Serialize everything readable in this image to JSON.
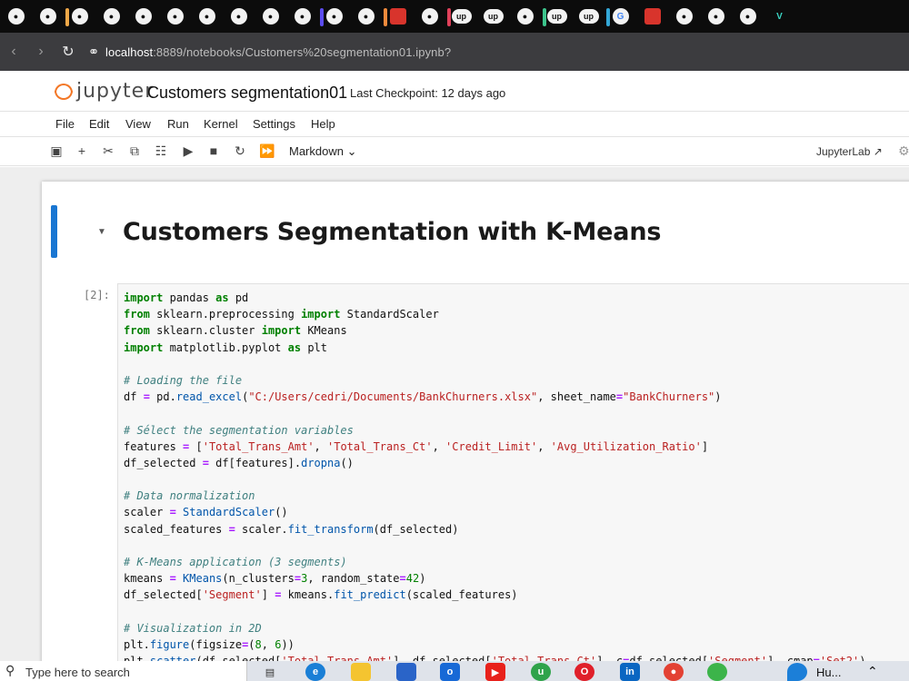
{
  "browser": {
    "tabs": [
      {
        "icon": "gh",
        "accent": "",
        "active": false
      },
      {
        "icon": "gh",
        "accent": "",
        "active": false
      },
      {
        "icon": "gh",
        "accent": "#f0a848",
        "active": false
      },
      {
        "icon": "gh",
        "accent": "",
        "active": false
      },
      {
        "icon": "gh",
        "accent": "",
        "active": false
      },
      {
        "icon": "gh",
        "accent": "",
        "active": false
      },
      {
        "icon": "gh",
        "accent": "",
        "active": false
      },
      {
        "icon": "gh",
        "accent": "",
        "active": false
      },
      {
        "icon": "gh",
        "accent": "",
        "active": false
      },
      {
        "icon": "gh",
        "accent": "",
        "active": false
      },
      {
        "icon": "gh",
        "accent": "#5b4cf0",
        "active": false
      },
      {
        "icon": "gh",
        "accent": "",
        "active": false
      },
      {
        "icon": "sq",
        "accent": "#f08a3c",
        "active": false
      },
      {
        "icon": "gh",
        "accent": "",
        "active": false
      },
      {
        "icon": "up",
        "accent": "#e0405a",
        "active": false
      },
      {
        "icon": "up",
        "accent": "",
        "active": false
      },
      {
        "icon": "gh",
        "accent": "",
        "active": false
      },
      {
        "icon": "up",
        "accent": "#3cc48c",
        "active": false
      },
      {
        "icon": "up",
        "accent": "",
        "active": false
      },
      {
        "icon": "G",
        "accent": "#34a8d8",
        "active": false
      },
      {
        "icon": "sq",
        "accent": "",
        "active": false
      },
      {
        "icon": "gh",
        "accent": "",
        "active": false
      },
      {
        "icon": "gh",
        "accent": "",
        "active": false
      },
      {
        "icon": "gh",
        "accent": "",
        "active": false
      },
      {
        "icon": "V",
        "accent": "",
        "active": false
      }
    ],
    "url_host": "localhost",
    "url_path": ":8889/notebooks/Customers%20segmentation01.ipynb?"
  },
  "jupyter": {
    "logo_text": "jupyter",
    "notebook_title": "Customers segmentation01",
    "checkpoint": "Last Checkpoint: 12 days ago",
    "menu": [
      "File",
      "Edit",
      "View",
      "Run",
      "Kernel",
      "Settings",
      "Help"
    ],
    "cell_type": "Markdown",
    "jupyterlab_link": "JupyterLab"
  },
  "notebook": {
    "heading": "Customers Segmentation with K-Means",
    "prompt": "[2]:",
    "code_lines": [
      "import pandas as pd",
      "from sklearn.preprocessing import StandardScaler",
      "from sklearn.cluster import KMeans",
      "import matplotlib.pyplot as plt",
      "",
      "# Loading the file",
      "df = pd.read_excel(\"C:/Users/cedri/Documents/BankChurners.xlsx\", sheet_name=\"BankChurners\")",
      "",
      "# Sélect the segmentation variables",
      "features = ['Total_Trans_Amt', 'Total_Trans_Ct', 'Credit_Limit', 'Avg_Utilization_Ratio']",
      "df_selected = df[features].dropna()",
      "",
      "# Data normalization",
      "scaler = StandardScaler()",
      "scaled_features = scaler.fit_transform(df_selected)",
      "",
      "# K-Means application (3 segments)",
      "kmeans = KMeans(n_clusters=3, random_state=42)",
      "df_selected['Segment'] = kmeans.fit_predict(scaled_features)",
      "",
      "# Visualization in 2D",
      "plt.figure(figsize=(8, 6))",
      "plt.scatter(df_selected['Total_Trans_Amt'], df_selected['Total_Trans_Ct'], c=df_selected['Segment'], cmap='Set2')"
    ]
  },
  "taskbar": {
    "search_placeholder": "Type here to search",
    "tray_app_label": "Hu..."
  },
  "colors": {
    "keyword": "#008000",
    "comment": "#408080",
    "string": "#ba2121",
    "function": "#0055aa",
    "number": "#008000",
    "accent": "#1976d2",
    "jupyter_orange": "#f37726"
  }
}
